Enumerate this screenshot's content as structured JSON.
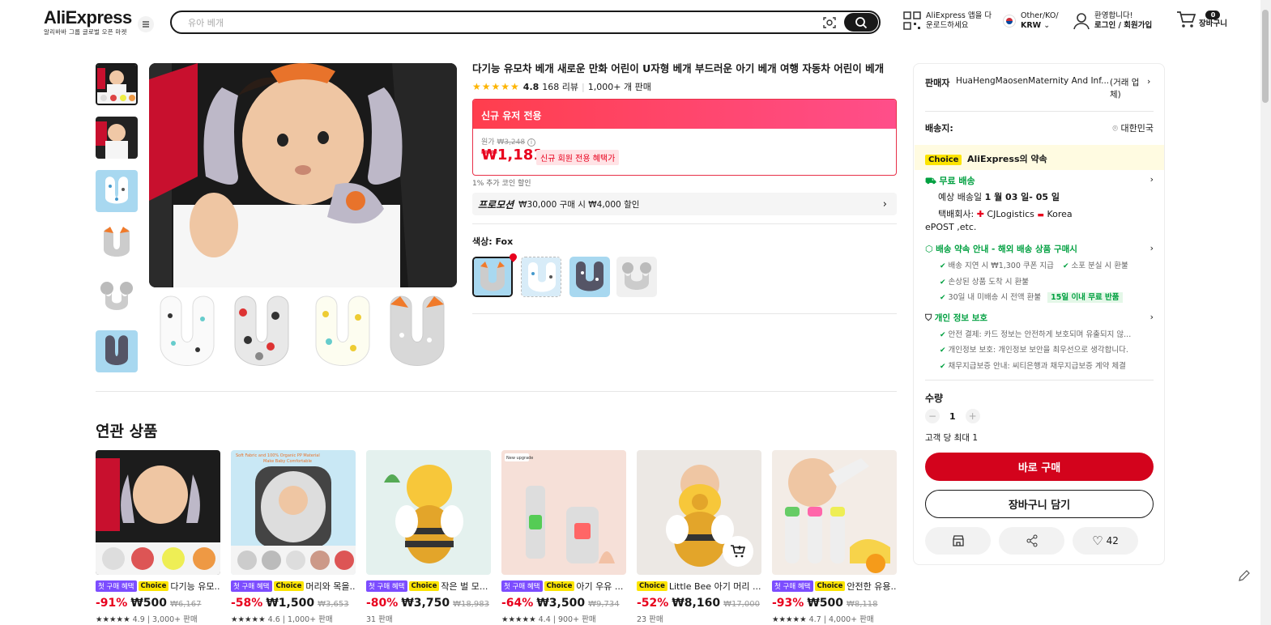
{
  "header": {
    "logo": "AliExpress",
    "logo_sub": "알리바바 그룹 글로벌 오픈 마켓",
    "search_placeholder": "유아 베개",
    "app_line1": "AliExpress 앱을 다",
    "app_line2": "운로드하세요",
    "region_line1": "Other/KO/",
    "region_line2": "KRW",
    "account_line1": "환영합니다!",
    "account_line2": "로그인 / 회원가입",
    "cart_count": "0",
    "cart_label": "장바구니"
  },
  "product": {
    "title": "다기능 유모차 베개 새로운 만화 어린이 U자형 베개 부드러운 아기 베개 여행 자동차 어린이 베개",
    "rating": "4.8",
    "reviews": "168 리뷰",
    "sold": "1,000+ 개 판매",
    "promo_header": "신규 유저 전용",
    "orig_label": "원가",
    "orig_price": "₩3,248",
    "price": "₩1,181",
    "new_tag": "신규 회원 전용 혜택가",
    "coin_note": "1% 추가 코인 할인",
    "promotion_label": "프로모션",
    "promotion_text": "₩30,000 구매 시 ₩4,000 할인",
    "color_label": "색상: Fox"
  },
  "panel": {
    "seller_label": "판매자",
    "seller_name": "HuaHengMaosenMaternity And Inf...",
    "seller_type": "(거래 업체)",
    "ship_to_label": "배송지:",
    "ship_to": "대한민국",
    "choice_tag": "Choice",
    "choice_promise": "AliExpress의 약속",
    "free_ship": "무료 배송",
    "eta_label": "예상 배송일",
    "eta": "1 월 03 일- 05 일",
    "carrier_label": "택배회사:",
    "carrier1": "CJLogistics",
    "carrier2": "Korea",
    "carrier3": "ePOST ,etc.",
    "delivery_guide": "배송 약속 안내 - 해외 배송 상품 구매시",
    "g1": "배송 지연 시 ₩1,300 쿠폰 지급",
    "g2": "소포 분실 시 환불",
    "g3": "손상된 상품 도착 시 환불",
    "g4": "30일 내 미배송 시 전액 환불",
    "g4_tag": "15일 이내 무료 반품",
    "privacy": "개인 정보 보호",
    "p1": "안전 결제: 카드 정보는 안전하게 보호되며 유출되지 않...",
    "p2": "개인정보 보호: 개인정보 보안을 최우선으로 생각합니다.",
    "p3": "채무지급보증 안내: 씨티은행과 채무지급보증 계약 체결",
    "qty_label": "수량",
    "qty": "1",
    "limit": "고객 당 최대 1",
    "buy_now": "바로 구매",
    "add_cart": "장바구니 담기",
    "wish_count": "42"
  },
  "related": {
    "title": "연관 상품",
    "items": [
      {
        "tag1": "첫 구매 혜택",
        "tag2": "Choice",
        "name": "다기능 유모...",
        "disc": "-91%",
        "price": "₩500",
        "old": "₩6,167",
        "meta": "4.9 | 3,000+ 판매"
      },
      {
        "tag1": "첫 구매 혜택",
        "tag2": "Choice",
        "name": "머리와 목을...",
        "disc": "-58%",
        "price": "₩1,500",
        "old": "₩3,653",
        "meta": "4.6 | 1,000+ 판매"
      },
      {
        "tag1": "첫 구매 혜택",
        "tag2": "Choice",
        "name": "작은 벌 모...",
        "disc": "-80%",
        "price": "₩3,750",
        "old": "₩18,983",
        "meta": "31 판매"
      },
      {
        "tag1": "첫 구매 혜택",
        "tag2": "Choice",
        "name": "아기 우유 ...",
        "disc": "-64%",
        "price": "₩3,500",
        "old": "₩9,734",
        "meta": "4.4 | 900+ 판매"
      },
      {
        "tag1": "",
        "tag2": "Choice",
        "name": "Little Bee 아기 머리 ...",
        "disc": "-52%",
        "price": "₩8,160",
        "old": "₩17,000",
        "meta": "23 판매"
      },
      {
        "tag1": "첫 구매 혜택",
        "tag2": "Choice",
        "name": "안전한 유용...",
        "disc": "-93%",
        "price": "₩500",
        "old": "₩8,118",
        "meta": "4.7 | 4,000+ 판매"
      }
    ]
  },
  "image_text": {
    "card2_banner": "Soft Fabric and 100% Organic PP Material Make Baby Comfortable",
    "card4_badge": "New upgrade"
  }
}
